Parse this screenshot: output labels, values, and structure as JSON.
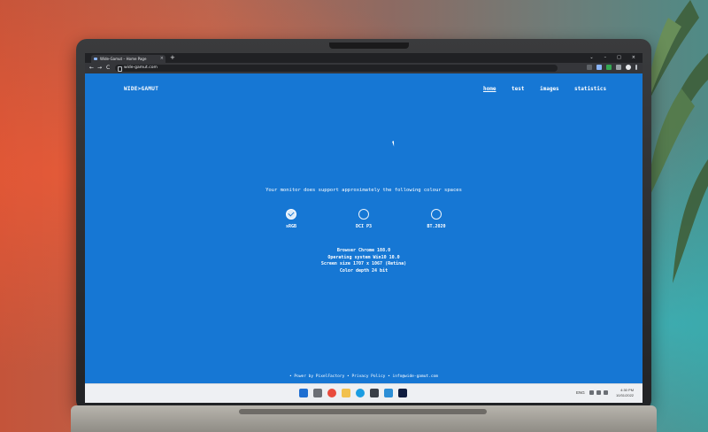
{
  "browser": {
    "tab_title": "Wide-Gamut – Home Page",
    "tab_close": "×",
    "new_tab": "+",
    "url": "wide-gamut.com",
    "back": "←",
    "forward": "→",
    "reload": "C",
    "win_min": "–",
    "win_max": "□",
    "win_close": "×",
    "tabs_menu": "⌄"
  },
  "site": {
    "logo": "WIDE>GAMUT",
    "nav": [
      "home",
      "test",
      "images",
      "statistics"
    ]
  },
  "main": {
    "headline": "Your monitor does support approximately the following colour spaces",
    "spaces": [
      {
        "label": "sRGB",
        "checked": true
      },
      {
        "label": "DCI P3",
        "checked": false
      },
      {
        "label": "BT.2020",
        "checked": false
      }
    ],
    "info": [
      "Browser Chrome 108.0",
      "Operating system Win10 10.0",
      "Screen size 1707 x 1067 (Retina)",
      "Color depth 24 bit"
    ]
  },
  "footer": {
    "text": "• Power by PixelFactory • Privacy Policy • info@wide-gamut.com"
  },
  "taskbar": {
    "lang": "ENG",
    "time": "4:30 PM",
    "date": "10/31/2022"
  },
  "colors": {
    "screen_blue": "#1677d4",
    "chrome_dark": "#202124",
    "taskbar": "#eef0f3"
  }
}
